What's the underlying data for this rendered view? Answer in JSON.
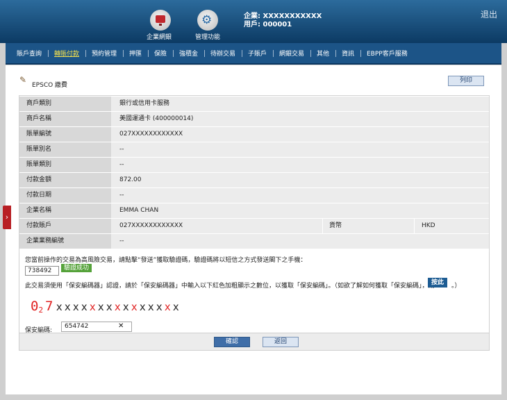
{
  "header": {
    "ebank_label": "企業網銀",
    "admin_label": "管理功能",
    "company": "企業: XXXXXXXXXXX",
    "user": "用戶: 000001",
    "logout": "退出"
  },
  "nav": [
    "賬戶查詢",
    "轉賬付款",
    "預約管理",
    "押匯",
    "保險",
    "強積金",
    "待辦交易",
    "子賬戶",
    "網銀交易",
    "其他",
    "資訊",
    "EBPP客戶服務"
  ],
  "page": {
    "title": "EPSCO 繳費",
    "print_label": "列印"
  },
  "rows": [
    {
      "label": "商戶類別",
      "value": "銀行或信用卡服務"
    },
    {
      "label": "商戶名稱",
      "value": "美國運通卡 (400000014)"
    },
    {
      "label": "賬單編號",
      "value": "027XXXXXXXXXXXX"
    },
    {
      "label": "賬單別名",
      "value": "--"
    },
    {
      "label": "賬單類別",
      "value": "--"
    },
    {
      "label": "付款金額",
      "value": "872.00"
    },
    {
      "label": "付款日期",
      "value": "--"
    },
    {
      "label": "企業名稱",
      "value": "EMMA CHAN"
    },
    {
      "label": "付款賬戶",
      "value": "027XXXXXXXXXXXX",
      "label2": "貨幣",
      "value2": "HKD"
    },
    {
      "label": "企業業務編號",
      "value": "--"
    }
  ],
  "verify": {
    "high_risk_notice": "您當前操作的交易為高風險交易，請點擊“發送”獲取驗證碼，驗證碼將以短信之方式發送閣下之手機：",
    "otp_value": "738492",
    "otp_status": "驗證成功",
    "token_instruction": "此交易須使用「保安編碼器」認證，請於「保安編碼器」中輸入以下紅色加粗顯示之數位，以獲取「保安編碼」。（如欲了解如何獲取「保安編碼」，請",
    "here_label": "按此",
    "instruction_tail": "。）",
    "token_label": "保安編碼:",
    "token_value": "654742"
  },
  "actions": {
    "confirm": "確認",
    "back": "返回"
  },
  "colors": {
    "accent": "#1c5487",
    "token_digit": "#e02020",
    "success": "#55a23a"
  }
}
